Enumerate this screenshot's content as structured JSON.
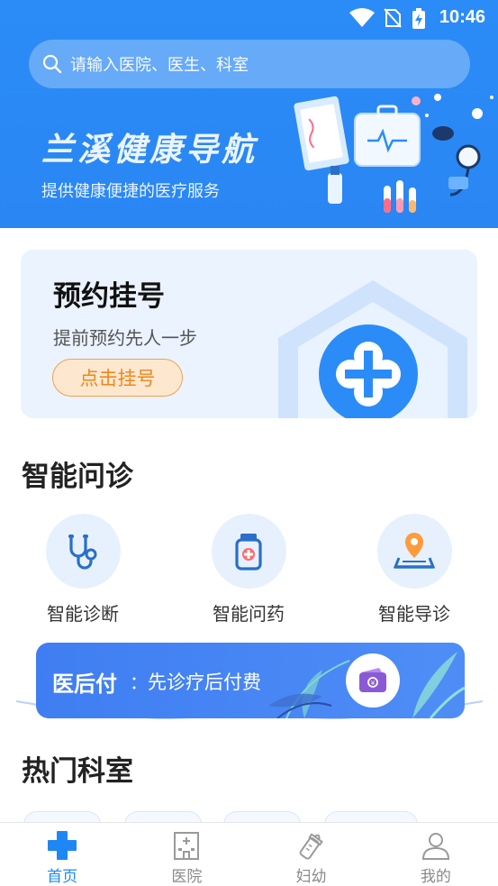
{
  "status_bar": {
    "time": "10:46"
  },
  "search": {
    "placeholder": "请输入医院、医生、科室"
  },
  "banner": {
    "brand": "兰溪健康导航",
    "slogan": "提供健康便捷的医疗服务"
  },
  "appointment": {
    "title": "预约挂号",
    "subtitle": "提前预约先人一步",
    "button": "点击挂号"
  },
  "smart": {
    "title": "智能问诊",
    "items": [
      {
        "label": "智能诊断",
        "icon": "stethoscope-icon"
      },
      {
        "label": "智能问药",
        "icon": "medicine-bottle-icon"
      },
      {
        "label": "智能导诊",
        "icon": "location-pin-icon"
      }
    ]
  },
  "pay_later": {
    "title": "医后付",
    "separator": "：",
    "desc": "先诊疗后付费"
  },
  "departments": {
    "title": "热门科室"
  },
  "tabbar": {
    "items": [
      {
        "label": "首页",
        "icon": "home-cross-icon",
        "active": true
      },
      {
        "label": "医院",
        "icon": "hospital-building-icon",
        "active": false
      },
      {
        "label": "妇幼",
        "icon": "baby-bottle-icon",
        "active": false
      },
      {
        "label": "我的",
        "icon": "user-icon",
        "active": false
      }
    ]
  },
  "colors": {
    "primary": "#2b8cf7",
    "accent_orange": "#f0861d",
    "card_bg": "#eaf3ff",
    "tab_active": "#1e87f5"
  }
}
